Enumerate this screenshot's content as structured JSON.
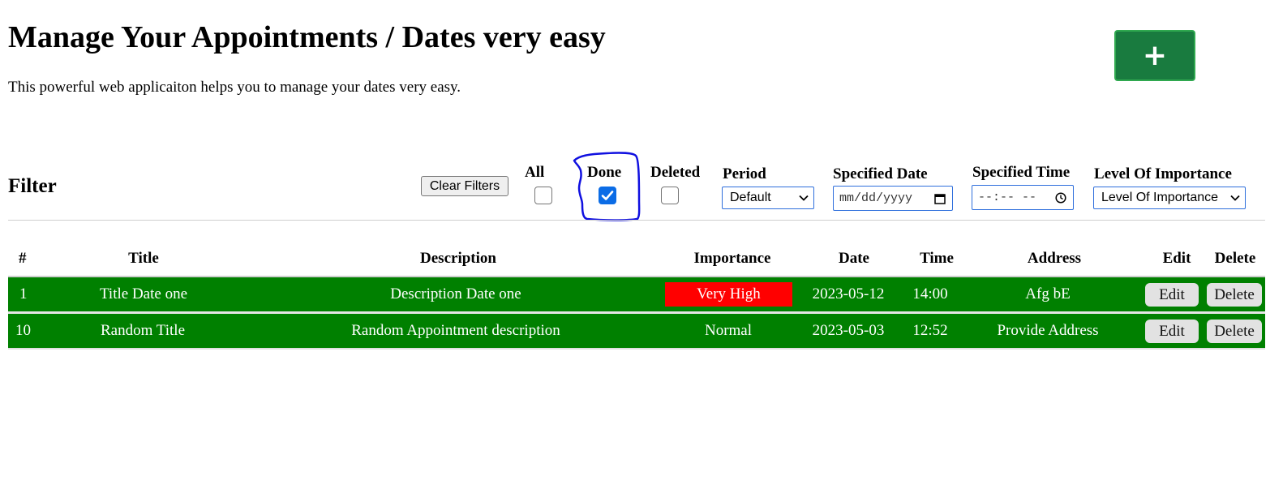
{
  "header": {
    "title": "Manage Your Appointments / Dates very easy",
    "subtitle": "This powerful web applicaiton helps you to manage your dates very easy.",
    "add_label": "+"
  },
  "filter": {
    "heading": "Filter",
    "clear_label": "Clear Filters",
    "checkboxes": [
      {
        "label": "All",
        "checked": false
      },
      {
        "label": "Done",
        "checked": true
      },
      {
        "label": "Deleted",
        "checked": false
      }
    ],
    "period": {
      "label": "Period",
      "value": "Default"
    },
    "specified_date": {
      "label": "Specified Date",
      "placeholder": "mm/dd/yyyy"
    },
    "specified_time": {
      "label": "Specified Time",
      "placeholder": "--:-- --"
    },
    "importance": {
      "label": "Level Of Importance",
      "value": "Level Of Importance"
    }
  },
  "table": {
    "columns": [
      "#",
      "Title",
      "Description",
      "Importance",
      "Date",
      "Time",
      "Address",
      "Edit",
      "Delete"
    ],
    "rows": [
      {
        "id": "1",
        "title": "Title Date one",
        "description": "Description Date one",
        "importance": "Very High",
        "date": "2023-05-12",
        "time": "14:00",
        "address": "Afg bE",
        "edit_label": "Edit",
        "delete_label": "Delete"
      },
      {
        "id": "10",
        "title": "Random Title",
        "description": "Random Appointment description",
        "importance": "Normal",
        "date": "2023-05-03",
        "time": "12:52",
        "address": "Provide Address",
        "edit_label": "Edit",
        "delete_label": "Delete"
      }
    ]
  },
  "colors": {
    "row_background": "#008000",
    "very_high_badge": "#ff0000",
    "add_button": "#197b3f",
    "annotation_stroke": "#1010e0"
  }
}
